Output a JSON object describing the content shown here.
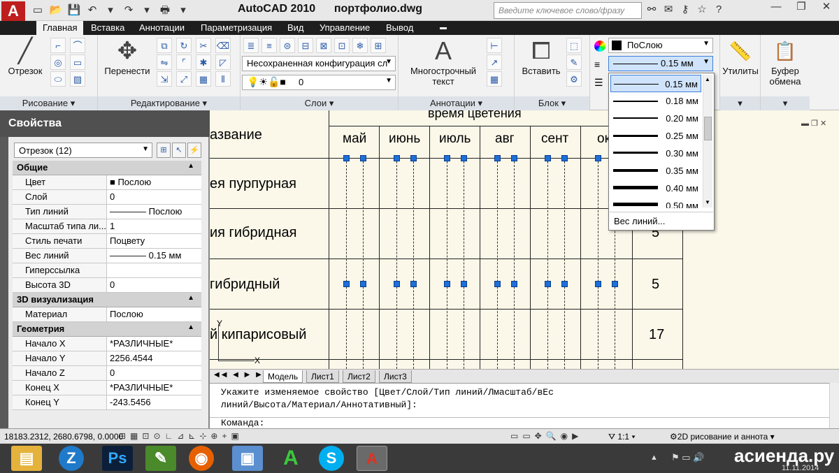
{
  "title": {
    "app": "AutoCAD 2010",
    "file": "портфолио.dwg"
  },
  "search": {
    "placeholder": "Введите ключевое слово/фразу"
  },
  "menu_tabs": [
    "Главная",
    "Вставка",
    "Аннотации",
    "Параметризация",
    "Вид",
    "Управление",
    "Вывод"
  ],
  "ribbon": {
    "draw": {
      "title": "Рисование",
      "line_label": "Отрезок"
    },
    "modify": {
      "title": "Редактирование",
      "move_label": "Перенести"
    },
    "layers": {
      "title": "Слои",
      "config_value": "Несохраненная конфигурация сл",
      "layer_value": "0"
    },
    "annotation": {
      "title": "Аннотации",
      "mtext_line1": "Многострочный",
      "mtext_line2": "текст"
    },
    "block": {
      "title": "Блок",
      "insert_label": "Вставить"
    },
    "properties": {
      "color_value": "ПоСлою",
      "lineweight_value": "0.15 мм"
    },
    "utilities": {
      "label": "Утилиты"
    },
    "clipboard": {
      "line1": "Буфер",
      "line2": "обмена"
    }
  },
  "lineweight_dropdown": {
    "items": [
      "0.15 мм",
      "0.18 мм",
      "0.20 мм",
      "0.25 мм",
      "0.30 мм",
      "0.35 мм",
      "0.40 мм",
      "0.50 мм"
    ],
    "selected": "0.15 мм",
    "more_label": "Вес линий..."
  },
  "properties_panel": {
    "title": "Свойства",
    "object": "Отрезок (12)",
    "sections": {
      "general": {
        "title": "Общие",
        "rows": [
          {
            "key": "Цвет",
            "value": "■ Послою"
          },
          {
            "key": "Слой",
            "value": "0"
          },
          {
            "key": "Тип линий",
            "value": "———— Послою"
          },
          {
            "key": "Масштаб типа ли...",
            "value": "1"
          },
          {
            "key": "Стиль печати",
            "value": "Поцвету"
          },
          {
            "key": "Вес линий",
            "value": "———— 0.15 мм"
          },
          {
            "key": "Гиперссылка",
            "value": ""
          },
          {
            "key": "Высота 3D",
            "value": "0"
          }
        ]
      },
      "viz": {
        "title": "3D визуализация",
        "rows": [
          {
            "key": "Материал",
            "value": "Послою"
          }
        ]
      },
      "geometry": {
        "title": "Геометрия",
        "rows": [
          {
            "key": "Начало X",
            "value": "*РАЗЛИЧНЫЕ*"
          },
          {
            "key": "Начало Y",
            "value": "2256.4544"
          },
          {
            "key": "Начало Z",
            "value": "0"
          },
          {
            "key": "Конец X",
            "value": "*РАЗЛИЧНЫЕ*"
          },
          {
            "key": "Конец Y",
            "value": "-243.5456"
          }
        ]
      }
    }
  },
  "drawing": {
    "header_partial": "время цветения",
    "col_name": "азвание",
    "months": [
      "май",
      "июнь",
      "июль",
      "авг",
      "сент",
      "ок"
    ],
    "rows": [
      {
        "name": "ея пурпурная",
        "value": ""
      },
      {
        "name": "ия гибридная",
        "value": "5"
      },
      {
        "name": " гибридный",
        "value": "5"
      },
      {
        "name": "й кипарисовый",
        "value": "17"
      }
    ],
    "ucs_y": "Y",
    "ucs_x": "X"
  },
  "layout_tabs": [
    "Модель",
    "Лист1",
    "Лист2",
    "Лист3"
  ],
  "command": {
    "line1": "Укажите изменяемое свойство [Цвет/Слой/Тип линий/Лмасштаб/вЕс",
    "line2": "линий/Высота/Материал/Аннотативный]:",
    "prompt": "Команда:"
  },
  "status": {
    "coords": "18183.2312, 2680.6798, 0.0000",
    "scale": "1:1",
    "workspace": "2D рисование и аннота"
  },
  "taskbar": {
    "watermark": "асиенда.ру",
    "date": "11.11.2014"
  }
}
